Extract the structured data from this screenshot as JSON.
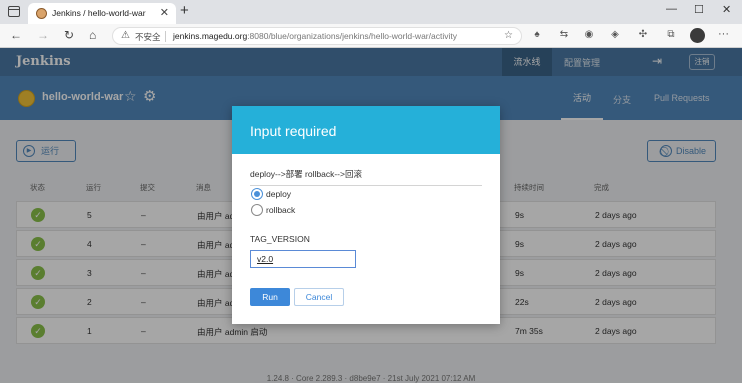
{
  "browser": {
    "tab_title": "Jenkins / hello-world-war",
    "tab_close": "✕",
    "new_tab": "+",
    "win_min": "—",
    "win_max": "☐",
    "win_close": "✕",
    "insecure_label": "不安全",
    "url_host": "jenkins.magedu.org",
    "url_rest": ":8080/blue/organizations/jenkins/hello-world-war/activity"
  },
  "jenkins": {
    "brand": "Jenkins",
    "nav_pipeline": "流水线",
    "nav_admin": "配置管理",
    "logout": "注销",
    "project_name": "hello-world-war",
    "tabs": [
      "活动",
      "分支",
      "Pull Requests"
    ]
  },
  "page": {
    "run_button": "运行",
    "disable_button": "Disable",
    "columns": [
      "状态",
      "运行",
      "提交",
      "消息",
      "持续时间",
      "完成"
    ],
    "rows": [
      {
        "run": "5",
        "commit": "–",
        "message": "由用户 ad",
        "duration": "9s",
        "completed": "2 days ago"
      },
      {
        "run": "4",
        "commit": "–",
        "message": "由用户 ad",
        "duration": "9s",
        "completed": "2 days ago"
      },
      {
        "run": "3",
        "commit": "–",
        "message": "由用户 ad",
        "duration": "9s",
        "completed": "2 days ago"
      },
      {
        "run": "2",
        "commit": "–",
        "message": "由用户 ad",
        "duration": "22s",
        "completed": "2 days ago"
      },
      {
        "run": "1",
        "commit": "–",
        "message": "由用户 admin 启动",
        "duration": "7m 35s",
        "completed": "2 days ago"
      }
    ],
    "footer": "1.24.8 · Core 2.289.3 · d8be9e7 · 21st July 2021 07:12 AM"
  },
  "modal": {
    "title": "Input required",
    "message": "deploy-->部署 rollback-->回滚",
    "options": [
      {
        "label": "deploy",
        "selected": true
      },
      {
        "label": "rollback",
        "selected": false
      }
    ],
    "param_label": "TAG_VERSION",
    "param_value": "v2.0",
    "run_label": "Run",
    "cancel_label": "Cancel"
  },
  "colors": {
    "jenkins_header": "#4a79a5",
    "jenkins_subheader": "#5289bd",
    "modal_header": "#25b0d9",
    "run_button": "#3d88d9",
    "success": "#8ac24b"
  }
}
